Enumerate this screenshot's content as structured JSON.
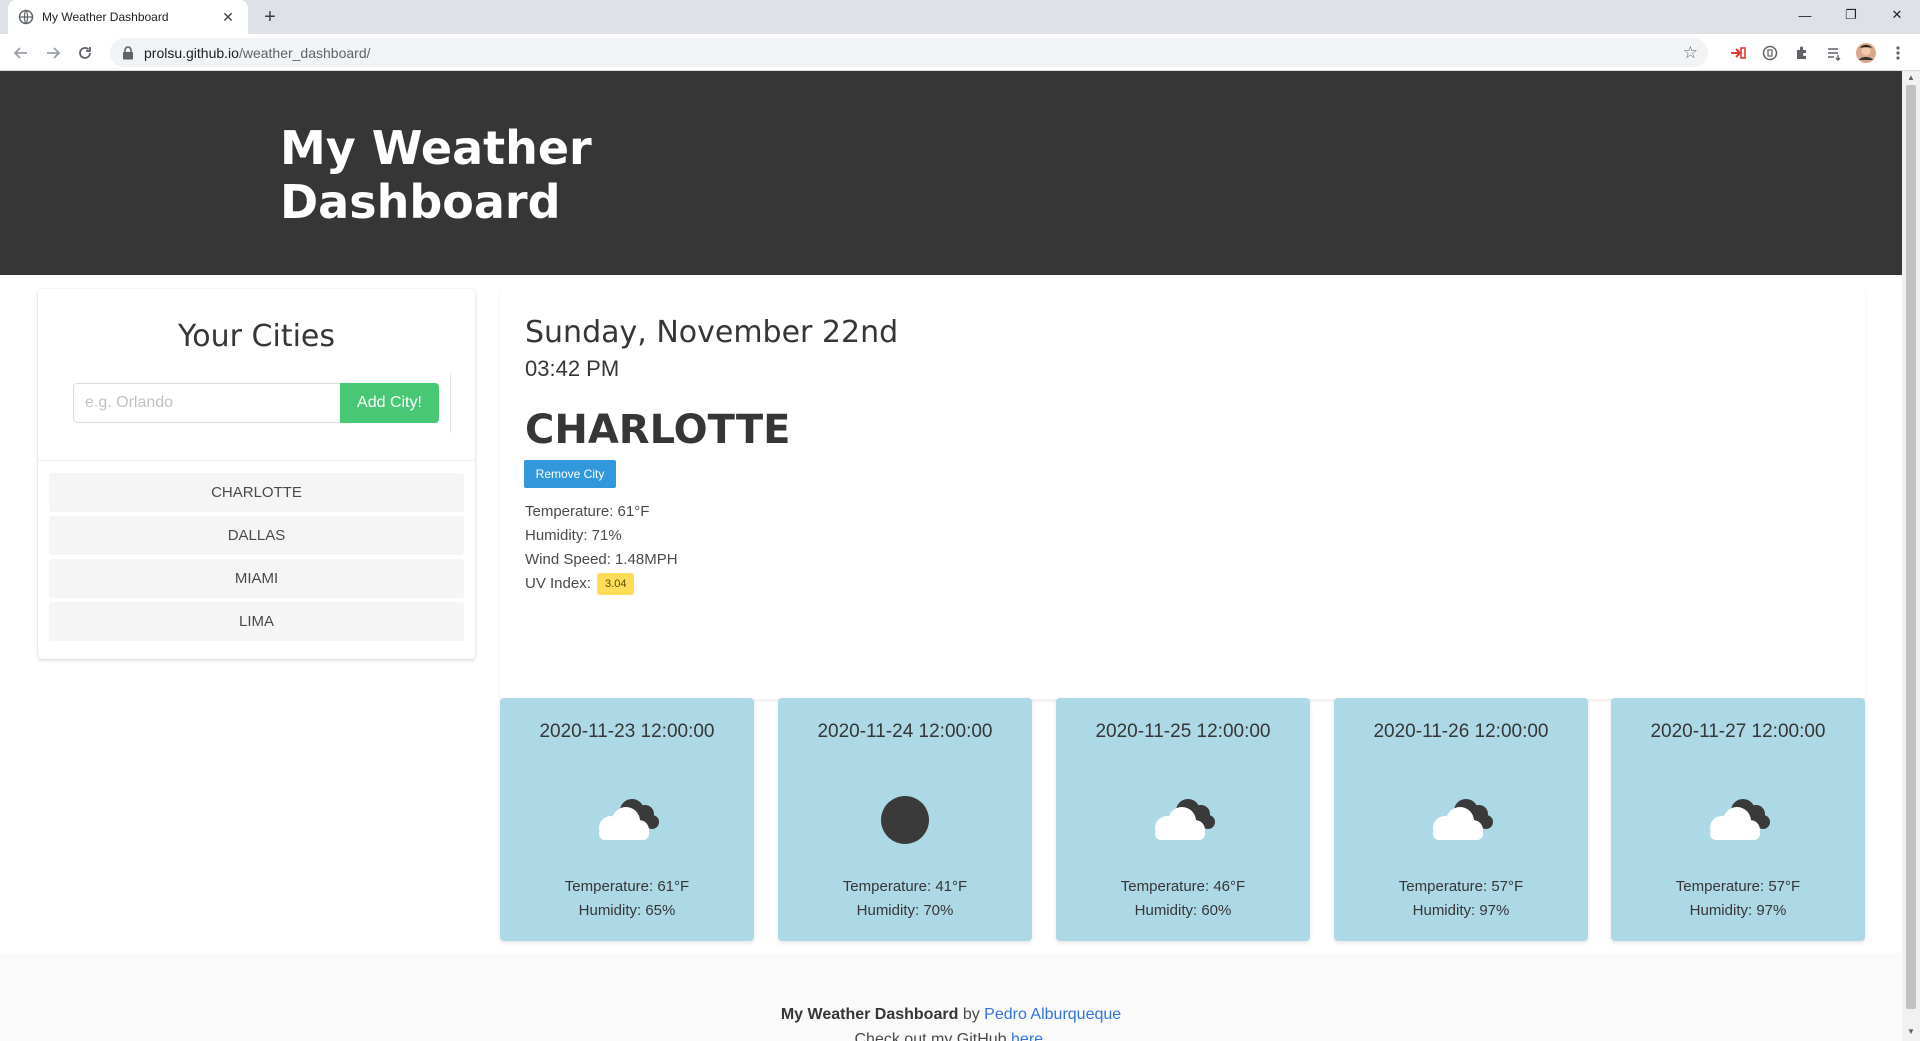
{
  "browser": {
    "tab_title": "My Weather Dashboard",
    "url_host": "prolsu.github.io",
    "url_path": "/weather_dashboard/",
    "window_controls": {
      "minimize": "—",
      "restore": "❐",
      "close": "✕"
    }
  },
  "hero": {
    "title": "My Weather Dashboard"
  },
  "cities": {
    "title": "Your Cities",
    "input_placeholder": "e.g. Orlando",
    "add_button": "Add City!",
    "items": [
      {
        "label": "CHARLOTTE"
      },
      {
        "label": "DALLAS"
      },
      {
        "label": "MIAMI"
      },
      {
        "label": "LIMA"
      }
    ]
  },
  "current": {
    "date": "Sunday, November 22nd",
    "time": "03:42 PM",
    "city": "CHARLOTTE",
    "remove_button": "Remove City",
    "temperature": "Temperature: 61°F",
    "humidity": "Humidity: 71%",
    "wind": "Wind Speed: 1.48MPH",
    "uv_label": "UV Index:",
    "uv_value": "3.04"
  },
  "forecast": [
    {
      "date": "2020-11-23 12:00:00",
      "icon": "cloudy-icon",
      "temperature": "Temperature: 61°F",
      "humidity": "Humidity: 65%"
    },
    {
      "date": "2020-11-24 12:00:00",
      "icon": "clear-sky-icon",
      "temperature": "Temperature: 41°F",
      "humidity": "Humidity: 70%"
    },
    {
      "date": "2020-11-25 12:00:00",
      "icon": "cloudy-icon",
      "temperature": "Temperature: 46°F",
      "humidity": "Humidity: 60%"
    },
    {
      "date": "2020-11-26 12:00:00",
      "icon": "cloudy-icon",
      "temperature": "Temperature: 57°F",
      "humidity": "Humidity: 97%"
    },
    {
      "date": "2020-11-27 12:00:00",
      "icon": "cloudy-icon",
      "temperature": "Temperature: 57°F",
      "humidity": "Humidity: 97%"
    }
  ],
  "footer": {
    "app_name": "My Weather Dashboard",
    "by": "by",
    "author": "Pedro Alburqueque",
    "github_text": "Check out my GitHub",
    "github_link": "here."
  },
  "colors": {
    "hero_bg": "#363636",
    "add_button": "#48c774",
    "remove_button": "#3298dc",
    "uv_badge": "#ffdd57",
    "forecast_card": "#add8e6",
    "link": "#3273dc"
  }
}
